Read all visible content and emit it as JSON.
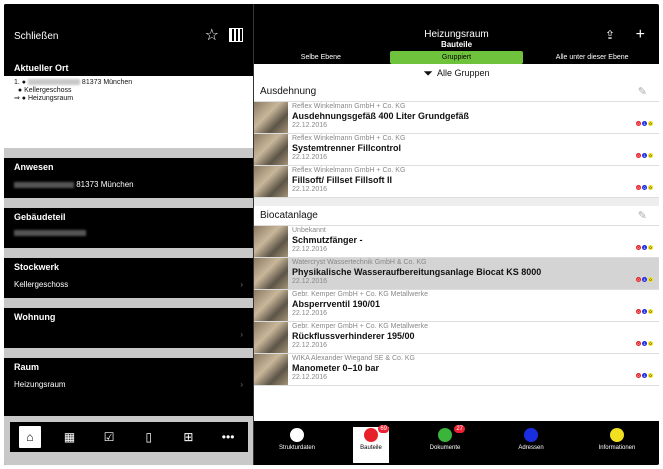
{
  "left": {
    "close_label": "Schließen",
    "current_location": {
      "title": "Aktueller Ort",
      "line1_suffix": "81373 München",
      "line2": "Kellergeschoss",
      "line3": "Heizungsraum",
      "prefix1": "1. ●",
      "prefix2": "● ",
      "prefix3": "⇒ ● "
    },
    "sections": [
      {
        "title": "Anwesen",
        "value": "81373 München"
      },
      {
        "title": "Gebäudeteil",
        "value": ""
      },
      {
        "title": "Stockwerk",
        "value": "Kellergeschoss"
      },
      {
        "title": "Wohnung",
        "value": ""
      },
      {
        "title": "Raum",
        "value": "Heizungsraum"
      }
    ],
    "tabs": [
      {
        "icon": "home-icon",
        "glyph": "⌂"
      },
      {
        "icon": "calendar-icon",
        "glyph": "▦"
      },
      {
        "icon": "checklist-icon",
        "glyph": "☑"
      },
      {
        "icon": "book-icon",
        "glyph": "▯"
      },
      {
        "icon": "hierarchy-icon",
        "glyph": "⊞"
      },
      {
        "icon": "more-icon",
        "glyph": "•••"
      }
    ]
  },
  "right": {
    "title": "Heizungsraum",
    "subtitle": "Bauteile",
    "segments": [
      "Selbe Ebene",
      "Gruppiert",
      "Alle unter dieser Ebene"
    ],
    "filter_label": "Alle Gruppen",
    "groups": [
      {
        "name": "Ausdehnung",
        "items": [
          {
            "maker": "Reflex Winkelmann GmbH + Co. KG",
            "name": "Ausdehnungsgefäß 400 Liter Grundgefäß",
            "date": "22.12.2016",
            "dots": [
              "0",
              "1",
              "0"
            ]
          },
          {
            "maker": "Reflex Winkelmann GmbH + Co. KG",
            "name": "Systemtrenner Fillcontrol",
            "date": "22.12.2016",
            "dots": [
              "0",
              "1",
              "0"
            ]
          },
          {
            "maker": "Reflex Winkelmann GmbH + Co. KG",
            "name": "Fillsoft/ Fillset Fillsoft II",
            "date": "22.12.2016",
            "dots": [
              "0",
              "0",
              "0"
            ]
          }
        ]
      },
      {
        "name": "Biocatanlage",
        "items": [
          {
            "maker": "Unbekannt",
            "name": "Schmutzfänger -",
            "date": "22.12.2016",
            "dots": [
              "0",
              "1",
              "0"
            ]
          },
          {
            "maker": "Watercryst Wassertechnik GmbH & Co. KG",
            "name": "Physikalische Wasseraufbereitungsanlage Biocat KS 8000",
            "date": "22.12.2016",
            "dots": [
              "0",
              "4",
              "0"
            ],
            "selected": true
          },
          {
            "maker": "Gebr. Kemper GmbH + Co. KG Metallwerke",
            "name": "Absperrventil 190/01",
            "date": "22.12.2016",
            "dots": [
              "0",
              "1",
              "0"
            ]
          },
          {
            "maker": "Gebr. Kemper GmbH + Co. KG Metallwerke",
            "name": "Rückflussverhinderer 195/00",
            "date": "22.12.2016",
            "dots": [
              "0",
              "1",
              "0"
            ]
          },
          {
            "maker": "WIKA Alexander Wiegand SE & Co. KG",
            "name": "Manometer 0–10 bar",
            "date": "22.12.2016",
            "dots": [
              "0",
              "1",
              "0"
            ]
          }
        ]
      }
    ],
    "tabs": [
      {
        "label": "Strukturdaten",
        "color": "#ffffff",
        "badge": ""
      },
      {
        "label": "Bauteile",
        "color": "#e8202a",
        "badge": "69"
      },
      {
        "label": "Dokumente",
        "color": "#3bb43b",
        "badge": "27"
      },
      {
        "label": "Adressen",
        "color": "#1a2ee0",
        "badge": ""
      },
      {
        "label": "Informationen",
        "color": "#f0e020",
        "badge": ""
      }
    ],
    "dot_colors": [
      "#e8202a",
      "#1a2ee0",
      "#f0e020"
    ]
  }
}
